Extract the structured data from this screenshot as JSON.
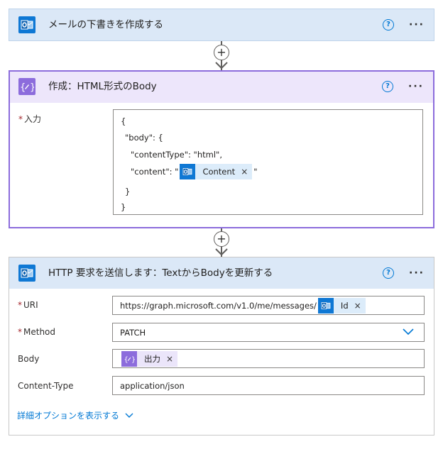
{
  "steps": [
    {
      "title": "メールの下書きを作成する",
      "icon": "outlook-icon"
    },
    {
      "title": "作成：HTML形式のBody",
      "icon": "compose-icon",
      "fields": {
        "input_label": "入力",
        "required_mark": "*",
        "json_lines": [
          "{",
          "\"body\": {",
          "\"contentType\": \"html\",",
          "\"content\": \"",
          "\"",
          "}",
          "}"
        ],
        "content_token": "Content"
      }
    },
    {
      "title": "HTTP 要求を送信します：TextからBodyを更新する",
      "icon": "outlook-icon",
      "fields": {
        "uri_label": "URI",
        "uri_value": "https://graph.microsoft.com/v1.0/me/messages/",
        "uri_token": "Id",
        "method_label": "Method",
        "method_value": "PATCH",
        "body_label": "Body",
        "body_token": "出力",
        "content_type_label": "Content-Type",
        "content_type_value": "application/json",
        "advanced_link": "詳細オプションを表示する"
      }
    }
  ],
  "common": {
    "help_glyph": "?",
    "more_glyph": "···",
    "add_glyph": "+",
    "remove_glyph": "×"
  },
  "colors": {
    "outlook_blue": "#0f78d4",
    "compose_purple": "#8c6cdc",
    "link_blue": "#0078d4",
    "required_red": "#a4262c"
  }
}
